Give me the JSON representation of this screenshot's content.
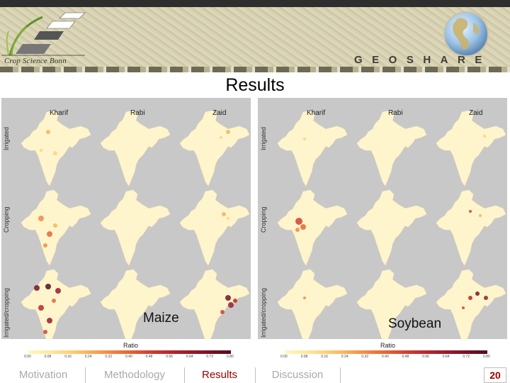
{
  "header": {
    "logo_text": "Crop Science Bonn",
    "brand": "GEOSHARE"
  },
  "slide": {
    "title": "Results",
    "page_number": "20"
  },
  "figure": {
    "columns": [
      "Kharif",
      "Rabi",
      "Zaid"
    ],
    "rows": [
      "Irrigated",
      "Cropping",
      "Irrigated/cropping"
    ],
    "panels": [
      {
        "crop": "Maize"
      },
      {
        "crop": "Soybean"
      }
    ],
    "colorbar": {
      "label": "Ratio",
      "ticks": [
        "0.00",
        "0.08",
        "0.16",
        "0.24",
        "0.32",
        "0.40",
        "0.48",
        "0.56",
        "0.64",
        "0.72",
        "0.80"
      ],
      "colors": [
        "#fff7c6",
        "#fde9a0",
        "#fbd37c",
        "#f7b15c",
        "#f08a45",
        "#e36637",
        "#cf4131",
        "#b8262d",
        "#981a2c",
        "#761226",
        "#540c20"
      ]
    },
    "background_color": "#c8c8c8",
    "map_color": "#fff5cc"
  },
  "nav": {
    "items": [
      {
        "label": "Motivation",
        "active": false
      },
      {
        "label": "Methodology",
        "active": false
      },
      {
        "label": "Results",
        "active": true
      },
      {
        "label": "Discussion",
        "active": false
      }
    ]
  }
}
